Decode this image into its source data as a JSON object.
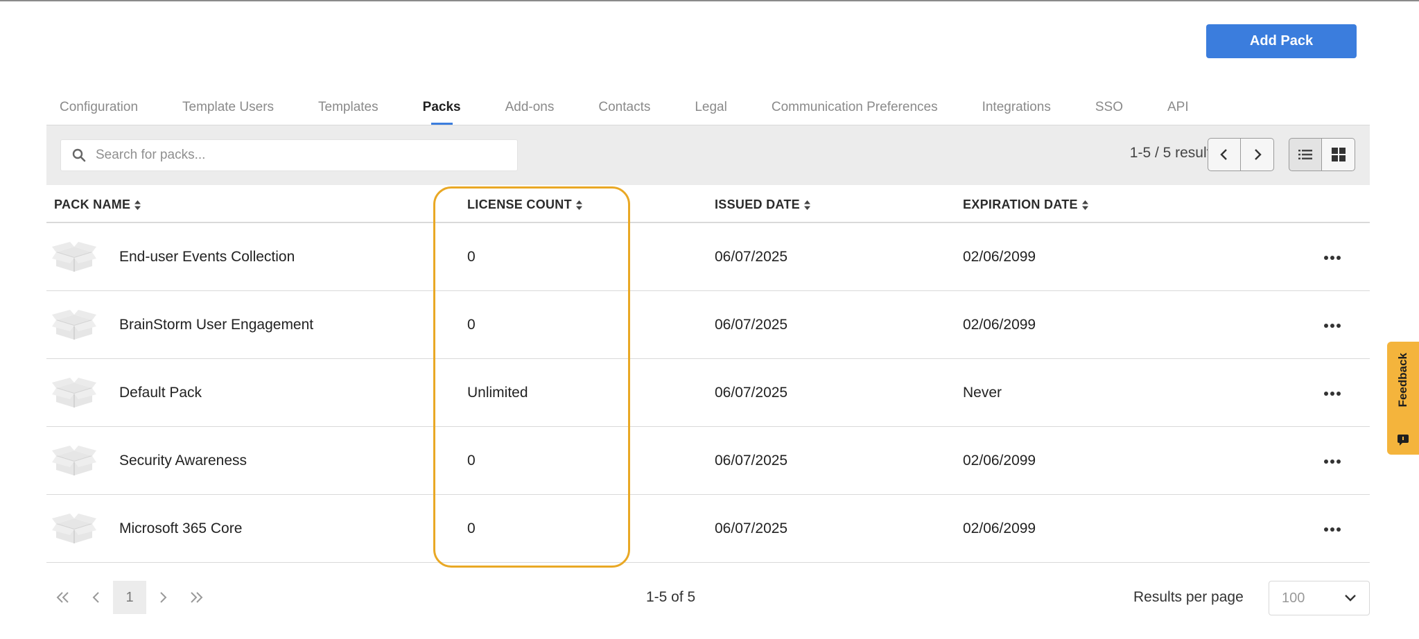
{
  "header": {
    "add_button": "Add Pack"
  },
  "tabs": [
    {
      "label": "Configuration"
    },
    {
      "label": "Template Users"
    },
    {
      "label": "Templates"
    },
    {
      "label": "Packs"
    },
    {
      "label": "Add-ons"
    },
    {
      "label": "Contacts"
    },
    {
      "label": "Legal"
    },
    {
      "label": "Communication Preferences"
    },
    {
      "label": "Integrations"
    },
    {
      "label": "SSO"
    },
    {
      "label": "API"
    }
  ],
  "active_tab": "Packs",
  "toolbar": {
    "search_placeholder": "Search for packs...",
    "results": "1-5 / 5 results"
  },
  "table": {
    "columns": [
      "PACK NAME",
      "LICENSE COUNT",
      "ISSUED DATE",
      "EXPIRATION DATE"
    ],
    "rows": [
      {
        "name": "End-user Events Collection",
        "license": "0",
        "issued": "06/07/2025",
        "expires": "02/06/2099"
      },
      {
        "name": "BrainStorm User Engagement",
        "license": "0",
        "issued": "06/07/2025",
        "expires": "02/06/2099"
      },
      {
        "name": "Default Pack",
        "license": "Unlimited",
        "issued": "06/07/2025",
        "expires": "Never"
      },
      {
        "name": "Security Awareness",
        "license": "0",
        "issued": "06/07/2025",
        "expires": "02/06/2099"
      },
      {
        "name": "Microsoft 365 Core",
        "license": "0",
        "issued": "06/07/2025",
        "expires": "02/06/2099"
      }
    ]
  },
  "footer": {
    "current_page": "1",
    "range": "1-5 of 5",
    "rpp_label": "Results per page",
    "rpp_value": "100"
  },
  "feedback": {
    "label": "Feedback"
  },
  "colors": {
    "accent": "#3b7ddd",
    "highlight": "#e9a825",
    "feedback": "#f4b43c"
  },
  "icons": [
    "search-icon",
    "chevron-left-icon",
    "chevron-right-icon",
    "list-view-icon",
    "grid-view-icon",
    "sort-icon",
    "package-icon",
    "more-icon",
    "double-chevron-left-icon",
    "double-chevron-right-icon",
    "chevron-down-icon",
    "chat-icon"
  ]
}
